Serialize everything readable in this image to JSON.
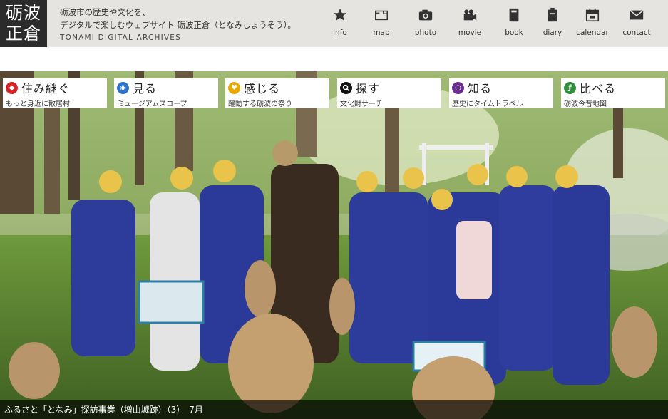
{
  "header": {
    "logo": [
      "砺波",
      "正倉"
    ],
    "tagline_line1": "砺波市の歴史や文化を、",
    "tagline_line2": "デジタルで楽しむウェブサイト 砺波正倉（となみしょうそう）。",
    "tagline_en": "TONAMI DIGITAL ARCHIVES"
  },
  "nav": [
    {
      "label": "info",
      "icon": "star-icon"
    },
    {
      "label": "map",
      "icon": "map-icon"
    },
    {
      "label": "photo",
      "icon": "camera-icon"
    },
    {
      "label": "movie",
      "icon": "movie-camera-icon"
    },
    {
      "label": "book",
      "icon": "book-icon"
    },
    {
      "label": "diary",
      "icon": "diary-icon"
    },
    {
      "label": "calendar",
      "icon": "calendar-icon"
    },
    {
      "label": "contact",
      "icon": "envelope-icon"
    }
  ],
  "menu": [
    {
      "title": "住み継ぐ",
      "sub": "もっと身近に散居村",
      "color": "#d6262b",
      "icon": "sumitsugu-icon",
      "glyph": "ᴬ"
    },
    {
      "title": "見る",
      "sub": "ミュージアムスコープ",
      "color": "#2a73c9",
      "icon": "eye-icon",
      "glyph": "◉"
    },
    {
      "title": "感じる",
      "sub": "躍動する砺波の祭り",
      "color": "#e8a800",
      "icon": "heart-icon",
      "glyph": "♥"
    },
    {
      "title": "探す",
      "sub": "文化財サーチ",
      "color": "#111111",
      "icon": "search-icon",
      "glyph": "⚲"
    },
    {
      "title": "知る",
      "sub": "歴史にタイムトラベル",
      "color": "#6b2c8f",
      "icon": "clock-icon",
      "glyph": "◷"
    },
    {
      "title": "比べる",
      "sub": "砺波今昔地図",
      "color": "#2f8f3a",
      "icon": "map-compare-icon",
      "glyph": "ƒ"
    }
  ],
  "caption": "ふるさと「となみ」探訪事業（増山城跡）（3）　7月"
}
